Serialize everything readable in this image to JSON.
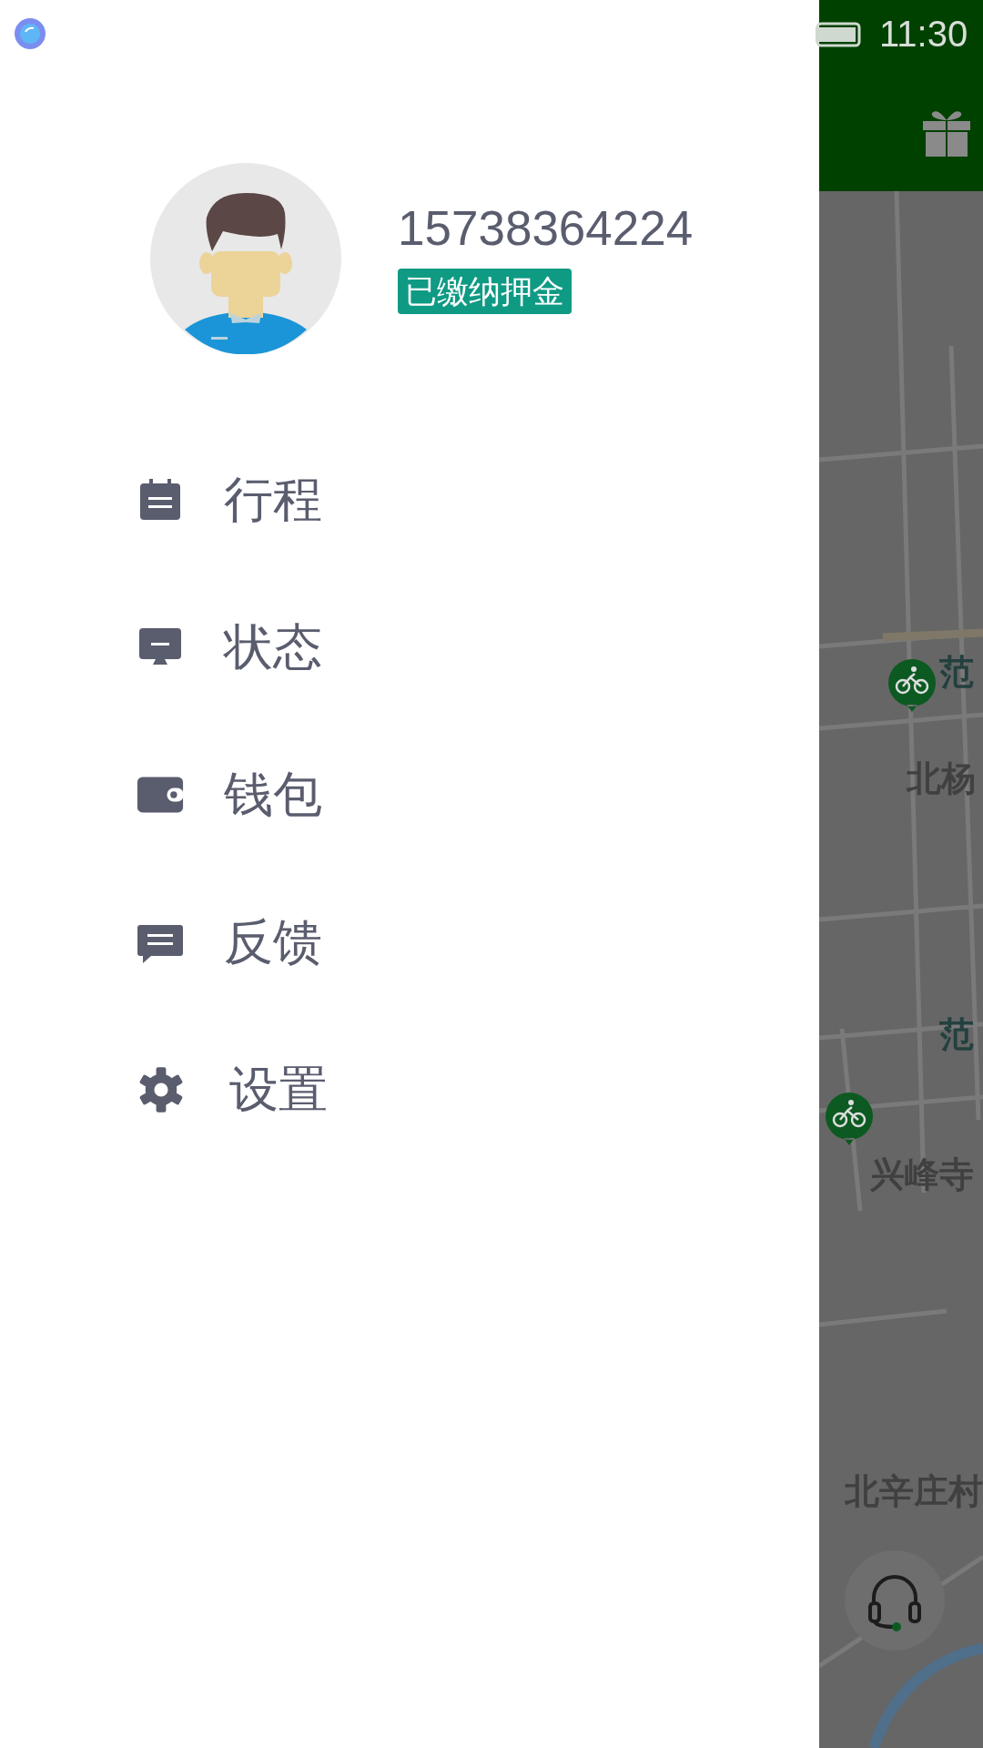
{
  "status_bar": {
    "time": "11:30"
  },
  "drawer": {
    "user": {
      "phone": "15738364224",
      "badge": "已缴纳押金"
    },
    "menu": [
      {
        "kind": "trips",
        "label": "行程"
      },
      {
        "kind": "status",
        "label": "状态"
      },
      {
        "kind": "wallet",
        "label": "钱包"
      },
      {
        "kind": "feedback",
        "label": "反馈"
      },
      {
        "kind": "settings",
        "label": "设置"
      }
    ]
  },
  "map": {
    "labels": [
      {
        "kind": "district",
        "text": "范"
      },
      {
        "kind": "place",
        "text": "北杨"
      },
      {
        "kind": "district",
        "text": "范"
      },
      {
        "kind": "place",
        "text": "兴峰寺"
      },
      {
        "kind": "place",
        "text": "北辛庄村"
      }
    ]
  }
}
